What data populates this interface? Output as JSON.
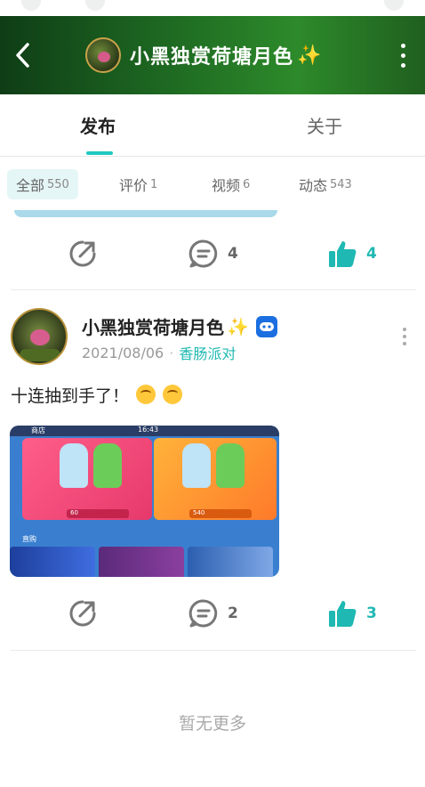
{
  "header": {
    "title": "小黑独赏荷塘月色"
  },
  "main_tabs": [
    {
      "label": "发布",
      "active": true
    },
    {
      "label": "关于",
      "active": false
    }
  ],
  "filters": [
    {
      "label": "全部",
      "count": "550",
      "active": true
    },
    {
      "label": "评价",
      "count": "1",
      "active": false
    },
    {
      "label": "视频",
      "count": "6",
      "active": false
    },
    {
      "label": "动态",
      "count": "543",
      "active": false
    }
  ],
  "prev_post": {
    "comments": "4",
    "likes": "4"
  },
  "post": {
    "author": "小黑独赏荷塘月色",
    "date": "2021/08/06",
    "group": "香肠派对",
    "text": "十连抽到手了！",
    "comments": "2",
    "likes": "3",
    "image": {
      "store_label": "商店",
      "time": "16:43",
      "price_1": "60",
      "price_2": "540",
      "section_label": "直购"
    }
  },
  "footer": {
    "end_text": "暂无更多"
  },
  "colors": {
    "accent": "#1fb8b2",
    "header_green": "#1e6a22",
    "like_teal": "#1fb8b2"
  },
  "icons": [
    "back-icon",
    "sparkle-icon",
    "more-vertical-icon",
    "share-icon",
    "comment-icon",
    "like-icon",
    "game-badge-icon"
  ]
}
